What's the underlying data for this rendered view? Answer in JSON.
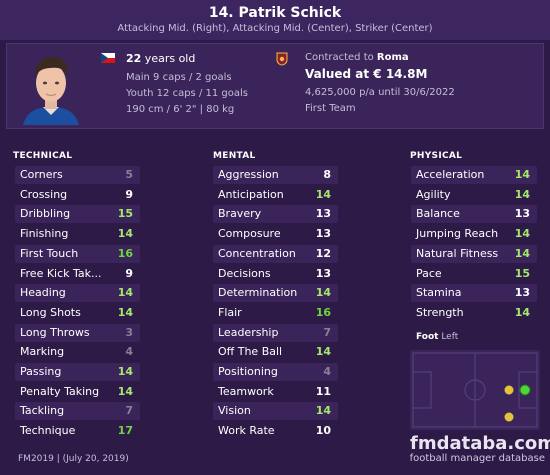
{
  "header": {
    "name": "14. Patrik Schick",
    "positions": "Attacking Mid. (Right), Attacking Mid. (Center), Striker (Center)"
  },
  "bio": {
    "age_value": "22",
    "age_suffix": " years old",
    "main_caps": "Main 9 caps / 2 goals",
    "youth_caps": "Youth 12 caps / 11 goals",
    "physical": "190 cm / 6' 2\" | 80 kg"
  },
  "contract": {
    "prefix": "Contracted to ",
    "club": "Roma",
    "value": "Valued at € 14.8M",
    "wage": "4,625,000 p/a until 30/6/2022",
    "squad": "First Team"
  },
  "colors": {
    "low": "#8a8096",
    "mid": "#ffffff",
    "good": "#a5e86c",
    "great": "#6fd640"
  },
  "technical": {
    "title": "TECHNICAL",
    "attributes": [
      {
        "label": "Corners",
        "value": "5"
      },
      {
        "label": "Crossing",
        "value": "9"
      },
      {
        "label": "Dribbling",
        "value": "15"
      },
      {
        "label": "Finishing",
        "value": "14"
      },
      {
        "label": "First Touch",
        "value": "16"
      },
      {
        "label": "Free Kick Tak...",
        "value": "9"
      },
      {
        "label": "Heading",
        "value": "14"
      },
      {
        "label": "Long Shots",
        "value": "14"
      },
      {
        "label": "Long Throws",
        "value": "3"
      },
      {
        "label": "Marking",
        "value": "4"
      },
      {
        "label": "Passing",
        "value": "14"
      },
      {
        "label": "Penalty Taking",
        "value": "14"
      },
      {
        "label": "Tackling",
        "value": "7"
      },
      {
        "label": "Technique",
        "value": "17"
      }
    ]
  },
  "mental": {
    "title": "MENTAL",
    "attributes": [
      {
        "label": "Aggression",
        "value": "8"
      },
      {
        "label": "Anticipation",
        "value": "14"
      },
      {
        "label": "Bravery",
        "value": "13"
      },
      {
        "label": "Composure",
        "value": "13"
      },
      {
        "label": "Concentration",
        "value": "12"
      },
      {
        "label": "Decisions",
        "value": "13"
      },
      {
        "label": "Determination",
        "value": "14"
      },
      {
        "label": "Flair",
        "value": "16"
      },
      {
        "label": "Leadership",
        "value": "7"
      },
      {
        "label": "Off The Ball",
        "value": "14"
      },
      {
        "label": "Positioning",
        "value": "4"
      },
      {
        "label": "Teamwork",
        "value": "11"
      },
      {
        "label": "Vision",
        "value": "14"
      },
      {
        "label": "Work Rate",
        "value": "10"
      }
    ]
  },
  "physical_attrs": {
    "title": "PHYSICAL",
    "attributes": [
      {
        "label": "Acceleration",
        "value": "14"
      },
      {
        "label": "Agility",
        "value": "14"
      },
      {
        "label": "Balance",
        "value": "13"
      },
      {
        "label": "Jumping Reach",
        "value": "14"
      },
      {
        "label": "Natural Fitness",
        "value": "14"
      },
      {
        "label": "Pace",
        "value": "15"
      },
      {
        "label": "Stamina",
        "value": "13"
      },
      {
        "label": "Strength",
        "value": "14"
      }
    ]
  },
  "foot": {
    "label": "Foot",
    "value": "Left"
  },
  "footer": {
    "version": "FM2019 | (July 20, 2019)",
    "brand": "fmdataba.com",
    "brand_sub": "football manager database"
  }
}
